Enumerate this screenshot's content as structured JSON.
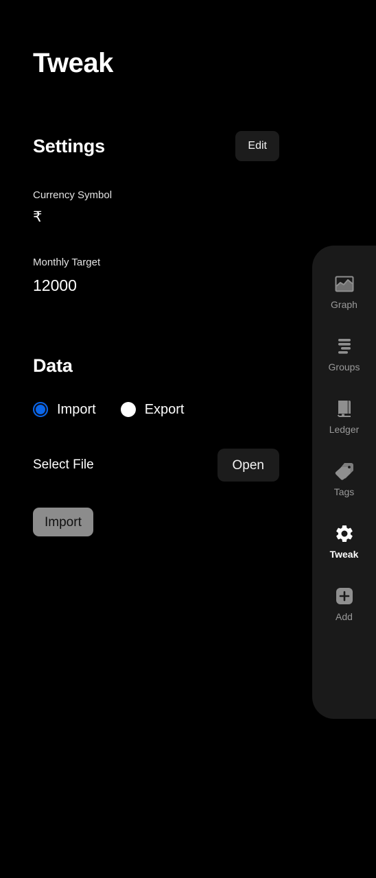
{
  "app": {
    "title": "Tweak",
    "background_color": "#000000"
  },
  "settings": {
    "title": "Settings",
    "edit_label": "Edit",
    "fields": [
      {
        "label": "Currency Symbol",
        "value": "₹"
      },
      {
        "label": "Monthly Target",
        "value": "12000"
      }
    ]
  },
  "data": {
    "title": "Data",
    "options": [
      {
        "label": "Import",
        "selected": true
      },
      {
        "label": "Export",
        "selected": false
      }
    ],
    "selected_option": "Import",
    "file_label": "Select File",
    "open_label": "Open",
    "import_label": "Import",
    "accent_color": "#0a66e8",
    "import_button_color": "#8c8c8c"
  },
  "nav": {
    "active": "Tweak",
    "active_color": "#ffffff",
    "inactive_color": "#9a9a9a",
    "panel_color": "#1a1a1a",
    "items": [
      {
        "label": "Graph",
        "icon": "graph-icon"
      },
      {
        "label": "Groups",
        "icon": "groups-icon"
      },
      {
        "label": "Ledger",
        "icon": "ledger-icon"
      },
      {
        "label": "Tags",
        "icon": "tags-icon"
      },
      {
        "label": "Tweak",
        "icon": "gear-icon"
      },
      {
        "label": "Add",
        "icon": "plus-square-icon"
      }
    ]
  }
}
